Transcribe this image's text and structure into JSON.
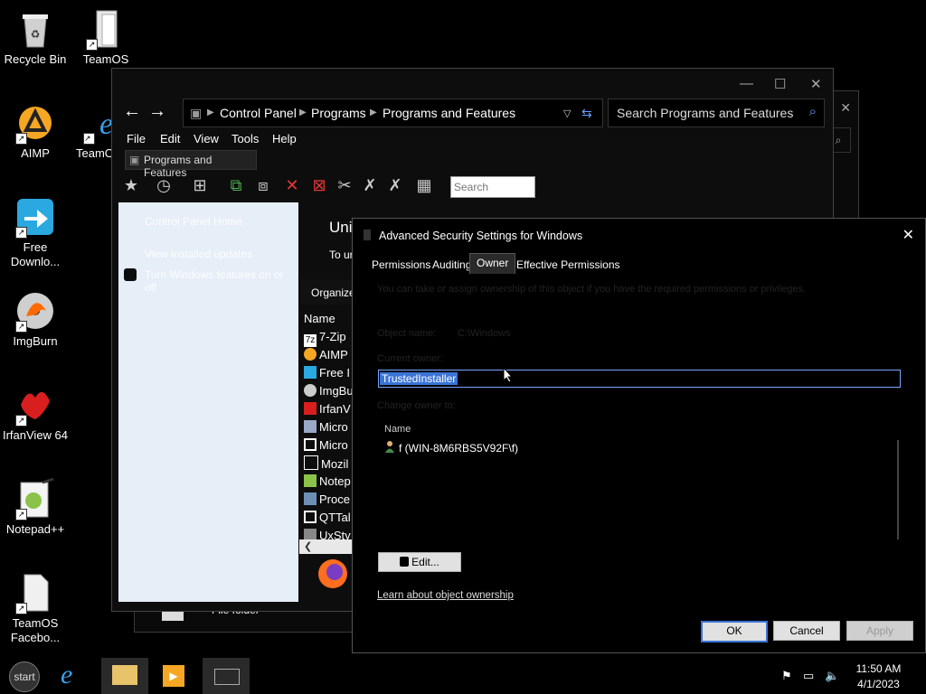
{
  "desktop": {
    "icons": [
      {
        "label": "Recycle Bin",
        "icon": "recycle-bin-icon"
      },
      {
        "label": "TeamOS",
        "icon": "folder-icon"
      },
      {
        "label": "AIMP",
        "icon": "aimp-icon"
      },
      {
        "label": "TeamO",
        "icon": "ie-icon"
      },
      {
        "label": "Free Downlo...",
        "icon": "download-icon"
      },
      {
        "label": "ImgBurn",
        "icon": "imgburn-icon"
      },
      {
        "label": "IrfanView 64",
        "icon": "irfanview-icon"
      },
      {
        "label": "Notepad++",
        "icon": "notepad-icon"
      },
      {
        "label": "TeamOS Facebo...",
        "icon": "file-icon"
      }
    ]
  },
  "explorer": {
    "breadcrumb": [
      "Control Panel",
      "Programs",
      "Programs and Features"
    ],
    "search_placeholder": "Search Programs and Features",
    "menu": [
      "File",
      "Edit",
      "View",
      "Tools",
      "Help"
    ],
    "tab_label": "Programs and Features",
    "toolbar_search_placeholder": "Search",
    "left_pane": [
      "Control Panel Home",
      "View installed updates",
      "Turn Windows features on or off"
    ],
    "heading": "Uni",
    "subheading": "To ur",
    "organize": "Organize",
    "column_name": "Name",
    "programs": [
      "7-Zip",
      "AIMP",
      "Free I",
      "ImgBu",
      "IrfanV",
      "Micro",
      "Micro",
      "Mozil",
      "Notep",
      "Proce",
      "QTTal",
      "UxSty"
    ],
    "back_window_text": "File folder"
  },
  "dialog": {
    "title": "Advanced Security Settings for Windows",
    "tabs": [
      "Permissions",
      "Auditing",
      "Owner",
      "Effective Permissions"
    ],
    "active_tab": "Owner",
    "info": "You can take or assign ownership of this object if you have the required permissions or privileges.",
    "object_name_label": "Object name:",
    "object_name_value": "C:\\Windows",
    "current_owner_label": "Current owner:",
    "current_owner_value": "TrustedInstaller",
    "change_owner_label": "Change owner to:",
    "name_column": "Name",
    "owner_entry": "f (WIN-8M6RBS5V92F\\f)",
    "edit_button": "Edit...",
    "learn_link": "Learn about object ownership",
    "ok": "OK",
    "cancel": "Cancel",
    "apply": "Apply"
  },
  "taskbar": {
    "start_label": "start",
    "time": "11:50 AM",
    "date": "4/1/2023"
  }
}
